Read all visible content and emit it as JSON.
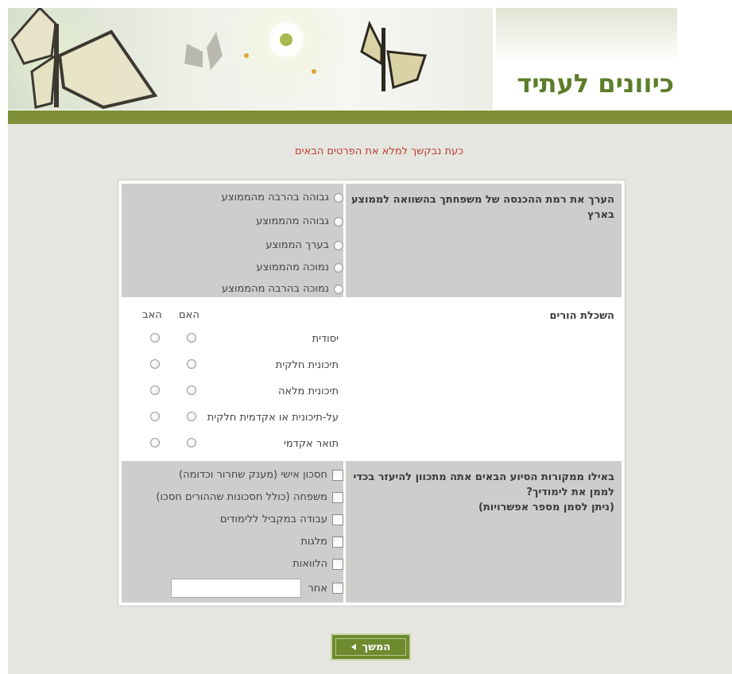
{
  "header": {
    "site_title": "כיוונים לעתיד"
  },
  "prompt": "כעת נבקשך למלא את הפרטים הבאים",
  "income": {
    "question": "הערך את רמת ההכנסה של משפחתך בהשוואה לממוצע בארץ",
    "options": [
      "גבוהה בהרבה מהממוצע",
      "גבוהה מהממוצע",
      "בערך הממוצע",
      "נמוכה מהממוצע",
      "נמוכה בהרבה מהממוצע"
    ]
  },
  "education": {
    "question": "השכלת הורים",
    "col_mother": "האם",
    "col_father": "האב",
    "levels": [
      "יסודית",
      "תיכונית חלקית",
      "תיכונית מלאה",
      "על-תיכונית או אקדמית חלקית",
      "תואר אקדמי"
    ]
  },
  "funding": {
    "question": "באילו ממקורות הסיוע הבאים אתה מתכוון להיעזר בכדי לממן את לימודיך?",
    "note": "(ניתן לסמן מספר אפשרויות)",
    "options": [
      "חסכון אישי (מענק שחרור וכדומה)",
      "משפחה (כולל חסכונות שההורים חסכו)",
      "עבודה במקביל ללימודים",
      "מלגות",
      "הלוואות",
      "אחר"
    ]
  },
  "next_button": "המשך"
}
